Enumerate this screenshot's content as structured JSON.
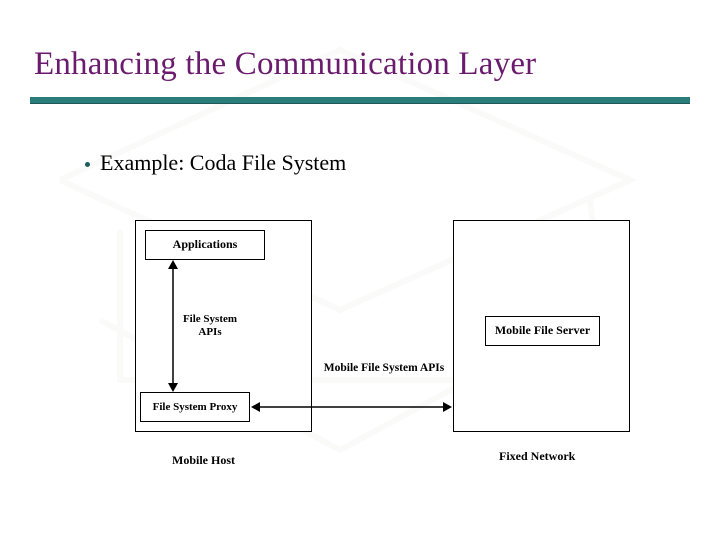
{
  "title": "Enhancing the Communication Layer",
  "bullet": "Example: Coda File System",
  "diagram": {
    "left_container": {
      "applications_box": "Applications",
      "file_system_apis_label": "File System APIs",
      "proxy_box": "File System Proxy",
      "caption": "Mobile Host"
    },
    "right_container": {
      "server_box": "Mobile File Server",
      "caption": "Fixed Network"
    },
    "connector_label": "Mobile File System APIs"
  },
  "chart_data": {
    "type": "diagram",
    "title": "Coda File System architecture example",
    "nodes": [
      {
        "id": "mobile_host_container",
        "label": "Mobile Host",
        "kind": "container"
      },
      {
        "id": "applications",
        "label": "Applications",
        "kind": "box",
        "parent": "mobile_host_container"
      },
      {
        "id": "file_system_proxy",
        "label": "File System Proxy",
        "kind": "box",
        "parent": "mobile_host_container"
      },
      {
        "id": "fixed_network_container",
        "label": "Fixed Network",
        "kind": "container"
      },
      {
        "id": "mobile_file_server",
        "label": "Mobile File Server",
        "kind": "box",
        "parent": "fixed_network_container"
      }
    ],
    "edges": [
      {
        "from": "applications",
        "to": "file_system_proxy",
        "label": "File System APIs",
        "bidirectional": true
      },
      {
        "from": "file_system_proxy",
        "to": "mobile_file_server",
        "label": "Mobile File System APIs",
        "bidirectional": true
      }
    ]
  }
}
